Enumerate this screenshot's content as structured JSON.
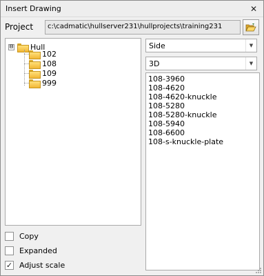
{
  "window": {
    "title": "Insert Drawing",
    "close_glyph": "✕"
  },
  "project": {
    "label": "Project",
    "path": "c:\\cadmatic\\hullserver231\\hullprojects\\training231",
    "browse_icon": "open-folder-icon"
  },
  "tree": {
    "root": {
      "label": "Hull",
      "expander": "⊟"
    },
    "children": [
      {
        "label": "102"
      },
      {
        "label": "108"
      },
      {
        "label": "109"
      },
      {
        "label": "999"
      }
    ]
  },
  "options": {
    "copy": {
      "label": "Copy",
      "checked": false
    },
    "expanded": {
      "label": "Expanded",
      "checked": false
    },
    "adjust_scale": {
      "label": "Adjust scale",
      "checked": true,
      "mark": "✓"
    }
  },
  "view_select": {
    "value": "Side"
  },
  "mode_select": {
    "value": "3D"
  },
  "drawings": [
    "108-3960",
    "108-4620",
    "108-4620-knuckle",
    "108-5280",
    "108-5280-knuckle",
    "108-5940",
    "108-6600",
    "108-s-knuckle-plate"
  ],
  "colors": {
    "folder": "#f2b735",
    "border": "#a9a9a9",
    "background": "#f0f0f0"
  }
}
